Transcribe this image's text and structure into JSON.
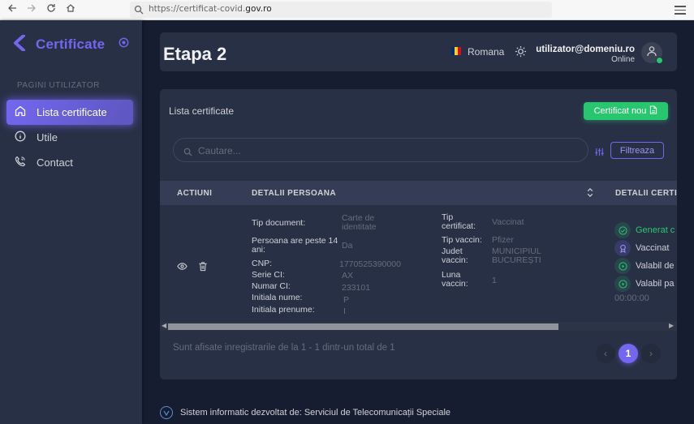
{
  "browser": {
    "url_prefix": "https://certificat-covid.",
    "url_domain": "gov.ro"
  },
  "sidebar": {
    "brand": "Certificate",
    "section_label": "PAGINI UTILIZATOR",
    "items": [
      {
        "label": "Lista certificate",
        "icon": "home-icon",
        "active": true
      },
      {
        "label": "Utile",
        "icon": "info-icon"
      },
      {
        "label": "Contact",
        "icon": "phone-icon"
      }
    ]
  },
  "navbar": {
    "title": "Etapa 2",
    "language": "Romana",
    "user_email": "utilizator@domeniu.ro",
    "user_status": "Online"
  },
  "card": {
    "title": "Lista certificate",
    "new_button": "Certificat nou",
    "search_placeholder": "Cautare...",
    "filter_button": "Filtreaza",
    "columns": [
      "ACTIUNI",
      "DETALII PERSOANA",
      "DETALII CERTI"
    ],
    "row": {
      "person_labels": [
        "Tip document:",
        "Persoana are peste 14 ani:",
        "CNP:",
        "Serie CI:",
        "Numar CI:",
        "Initiala nume:",
        "Initiala prenume:"
      ],
      "person_values": [
        "Carte de identitate",
        "Da",
        "1770525390000",
        "AX",
        "233101",
        "P",
        "I"
      ],
      "cert_labels": [
        "Tip certificat:",
        "Tip vaccin:",
        "Judet vaccin:",
        "Luna vaccin:"
      ],
      "cert_values": [
        "Vaccinat",
        "Pfizer",
        "MUNICIPIUL BUCUREȘTI",
        "1"
      ],
      "status": [
        {
          "label": "Generat c",
          "color": "#28c76f"
        },
        {
          "label": "Vaccinat",
          "color": "#d0d2d6"
        },
        {
          "label": "Valabil de",
          "color": "#d0d2d6"
        },
        {
          "label": "Valabil pa",
          "color": "#d0d2d6"
        }
      ],
      "time": "00:00:00"
    },
    "info_text": "Sunt afisate inregistrarile de la 1 - 1 dintr-un total de 1",
    "pagination": {
      "prev": "‹",
      "current": "1",
      "next": "›"
    }
  },
  "footer": {
    "text": "Sistem informatic dezvoltat de: Serviciul de Telecomunicații Speciale"
  },
  "colors": {
    "primary": "#7367f0",
    "success": "#28c76f",
    "background": "#161d31",
    "card": "#283046"
  }
}
